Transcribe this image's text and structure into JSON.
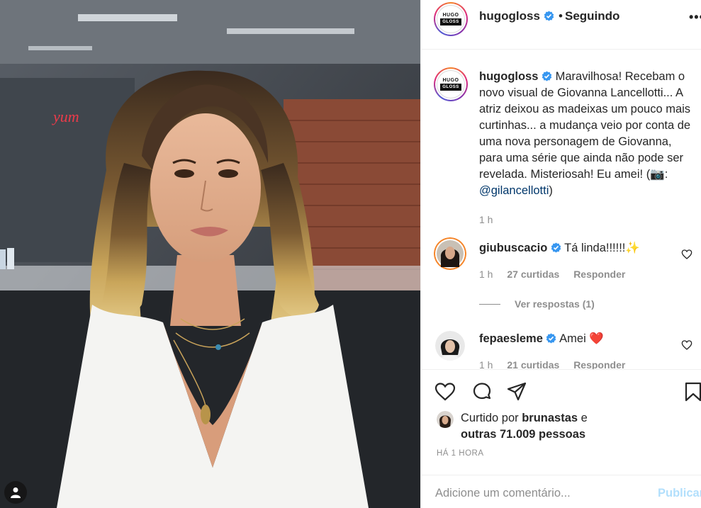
{
  "post": {
    "username": "hugogloss",
    "follow_status": "Seguindo",
    "dot": "•",
    "more": "•••",
    "logo": {
      "line1": "HUGO",
      "line2": "GLOSS"
    }
  },
  "caption": {
    "username": "hugogloss",
    "text_before": "Maravilhosa! Recebam o novo visual de Giovanna Lancellotti... A atriz deixou as madeixas um pouco mais curtinhas... a mudança veio por conta de uma nova personagem de Giovanna, para uma série que ainda não pode ser revelada. Misteriosah! Eu amei! (📷: ",
    "mention": "@gilancellotti",
    "text_after": ")",
    "time": "1 h"
  },
  "comments": [
    {
      "username": "giubuscacio",
      "text": "Tá linda!!!!!!✨",
      "time": "1 h",
      "likes": "27 curtidas",
      "reply": "Responder"
    },
    {
      "username": "fepaesleme",
      "text": "Amei ❤️",
      "time": "1 h",
      "likes": "21 curtidas",
      "reply": "Responder"
    }
  ],
  "view_replies": "Ver respostas (1)",
  "likes": {
    "prefix": "Curtido por ",
    "user": "brunastas",
    "middle": " e",
    "others": "outras 71.009 pessoas"
  },
  "time_ago": "HÁ 1 HORA",
  "add_comment": {
    "placeholder": "Adicione um comentário...",
    "publish": "Publicar"
  },
  "icons": [
    "user-tag-icon",
    "verified-icon",
    "more-icon",
    "heart-icon",
    "comment-icon",
    "share-icon",
    "bookmark-icon"
  ],
  "colors": {
    "verified": "#3897f0",
    "link": "#00376b",
    "muted": "#8e8e8e",
    "publish_disabled": "#b2dffc",
    "heart_red": "#ed4956"
  }
}
